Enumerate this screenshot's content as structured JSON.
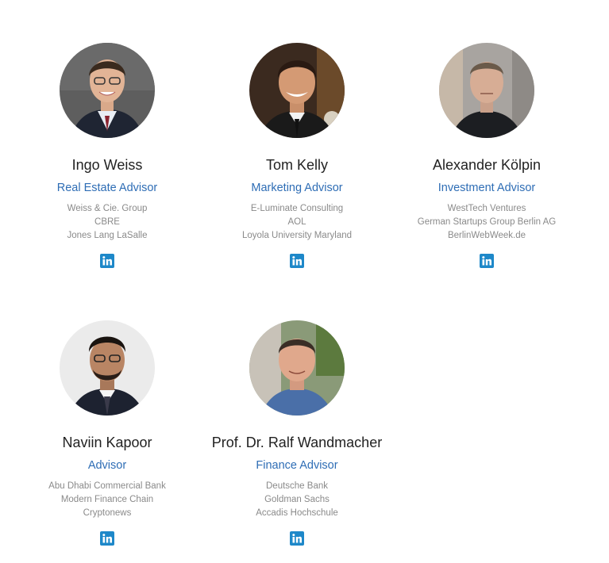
{
  "advisors": [
    {
      "name": "Ingo Weiss",
      "role": "Real Estate Advisor",
      "companies": [
        "Weiss & Cie. Group",
        "CBRE",
        "Jones Lang LaSalle"
      ],
      "icon": "linkedin-icon",
      "photo_bg": "#5a5a5a"
    },
    {
      "name": "Tom Kelly",
      "role": "Marketing Advisor",
      "companies": [
        "E-Luminate Consulting",
        "AOL",
        "Loyola University Maryland"
      ],
      "icon": "linkedin-icon",
      "photo_bg": "#3a2a20"
    },
    {
      "name": "Alexander Kölpin",
      "role": "Investment Advisor",
      "companies": [
        "WestTech Ventures",
        "German Startups Group Berlin AG",
        "BerlinWebWeek.de"
      ],
      "icon": "linkedin-icon",
      "photo_bg": "#9a9a9a"
    },
    {
      "name": "Naviin Kapoor",
      "role": "Advisor",
      "companies": [
        "Abu Dhabi Commercial Bank",
        "Modern Finance Chain",
        "Cryptonews"
      ],
      "icon": "linkedin-icon",
      "photo_bg": "#e8e8e8"
    },
    {
      "name": "Prof. Dr. Ralf Wandmacher",
      "role": "Finance Advisor",
      "companies": [
        "Deutsche Bank",
        "Goldman Sachs",
        "Accadis Hochschule"
      ],
      "icon": "linkedin-icon",
      "photo_bg": "#7a8a6a"
    }
  ],
  "colors": {
    "role": "#2e6db5",
    "linkedin": "#1e88c9",
    "name": "#222222",
    "company": "#8a8a8a"
  }
}
